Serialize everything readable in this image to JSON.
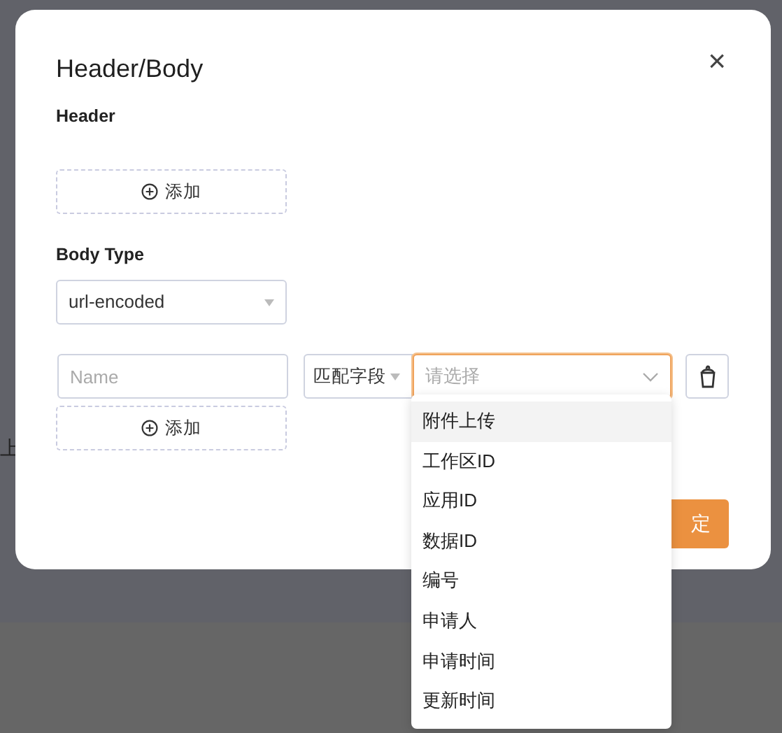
{
  "backdrop": {
    "text": "上"
  },
  "dialog": {
    "title": "Header/Body",
    "close": "×",
    "header_section": {
      "label": "Header",
      "add_button": "添加"
    },
    "body_section": {
      "label": "Body Type",
      "body_type": "url-encoded",
      "row": {
        "name_placeholder": "Name",
        "match_type": "匹配字段",
        "field_placeholder": "请选择",
        "field_focused": true
      },
      "add_button": "添加"
    },
    "confirm_button": "定"
  },
  "dropdown": {
    "options": [
      {
        "label": "附件上传",
        "selected": true
      },
      {
        "label": "工作区ID",
        "selected": false
      },
      {
        "label": "应用ID",
        "selected": false
      },
      {
        "label": "数据ID",
        "selected": false
      },
      {
        "label": "编号",
        "selected": false
      },
      {
        "label": "申请人",
        "selected": false
      },
      {
        "label": "申请时间",
        "selected": false
      },
      {
        "label": "更新时间",
        "selected": false
      }
    ]
  }
}
